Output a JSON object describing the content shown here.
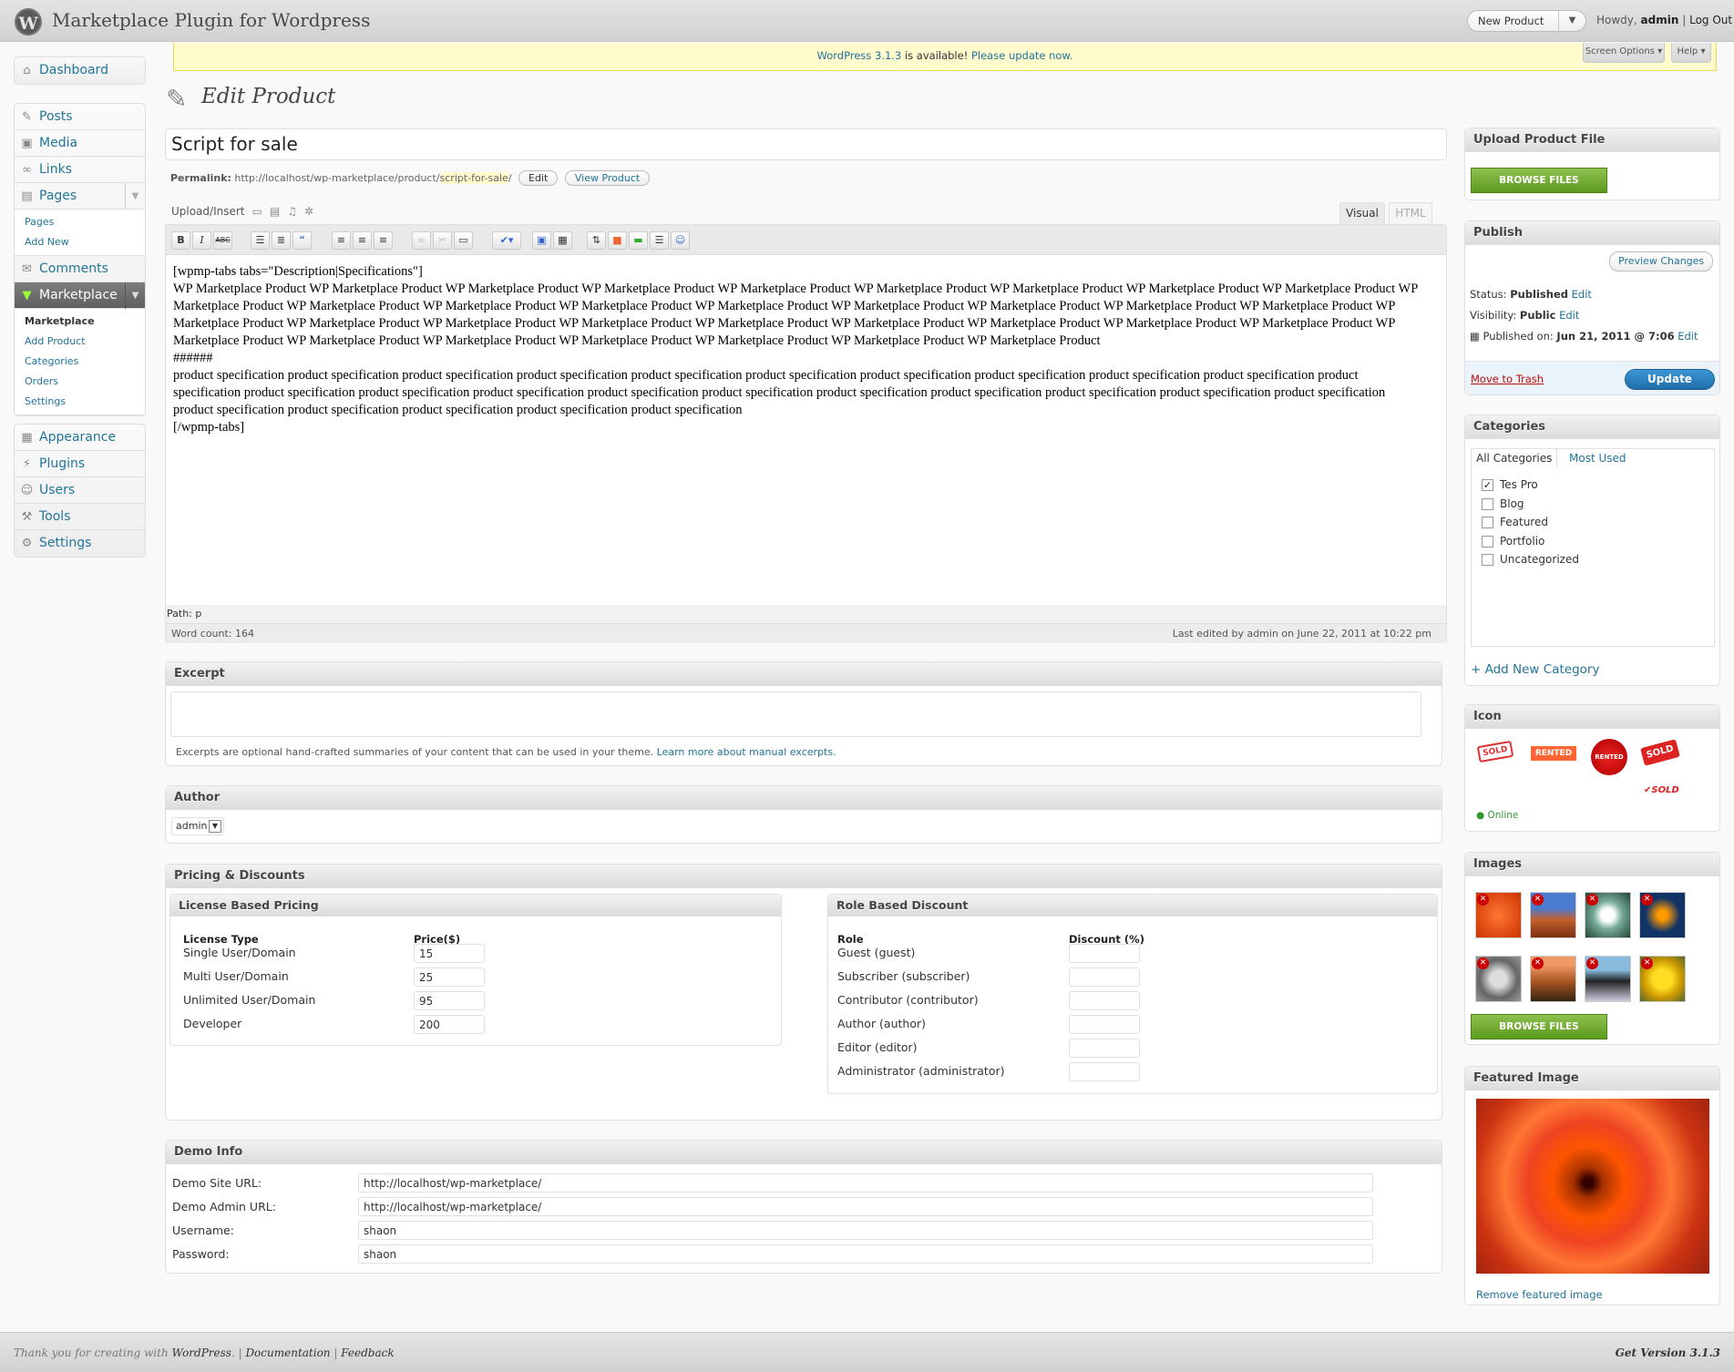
{
  "header": {
    "site_title": "Marketplace Plugin for Wordpress",
    "new_button": "New Product",
    "howdy": "Howdy,",
    "user": "admin",
    "separator": "|",
    "logout": "Log Out"
  },
  "nag": {
    "link1": "WordPress 3.1.3",
    "text": " is available! ",
    "link2": "Please update now."
  },
  "screen_options": "Screen Options",
  "help": "Help",
  "menu": {
    "dashboard": "Dashboard",
    "posts": "Posts",
    "media": "Media",
    "links": "Links",
    "pages": "Pages",
    "pages_sub": [
      "Pages",
      "Add New"
    ],
    "comments": "Comments",
    "marketplace": "Marketplace",
    "marketplace_sub": [
      "Marketplace",
      "Add Product",
      "Categories",
      "Orders",
      "Settings"
    ],
    "appearance": "Appearance",
    "plugins": "Plugins",
    "users": "Users",
    "tools": "Tools",
    "settings": "Settings"
  },
  "page": {
    "title": "Edit Product",
    "post_title": "Script for sale",
    "permalink_label": "Permalink:",
    "permalink_base": "http://localhost/wp-marketplace/product/",
    "permalink_slug": "script-for-sale",
    "permalink_end": "/",
    "edit_btn": "Edit",
    "view_btn": "View Product",
    "upload_insert": "Upload/Insert",
    "tab_visual": "Visual",
    "tab_html": "HTML"
  },
  "editor": {
    "line1": "[wpmp-tabs tabs=\"Description|Specifications\"]",
    "para1": "WP Marketplace Product WP Marketplace Product WP Marketplace Product WP Marketplace Product WP Marketplace Product WP Marketplace Product WP Marketplace Product WP Marketplace Product WP Marketplace Product WP Marketplace Product WP Marketplace Product WP Marketplace Product WP Marketplace Product WP Marketplace Product WP Marketplace Product WP Marketplace Product WP Marketplace Product WP Marketplace Product WP Marketplace Product WP Marketplace Product WP Marketplace Product WP Marketplace Product WP Marketplace Product WP Marketplace Product WP Marketplace Product WP Marketplace Product WP Marketplace Product WP Marketplace Product WP Marketplace Product WP Marketplace Product WP Marketplace Product WP Marketplace Product WP Marketplace Product WP Marketplace Product",
    "sep": "######",
    "para2": "product specification product specification product specification product specification product specification product specification product specification product specification product specification product specification product specification product specification product specification product specification product specification product specification product specification product specification product specification product specification product specification product specification product specification product specification product specification product specification",
    "line_end": "[/wpmp-tabs]",
    "path": "Path: p",
    "word_count": "Word count: 164",
    "last_edited": "Last edited by admin on June 22, 2011 at 10:22 pm"
  },
  "excerpt": {
    "title": "Excerpt",
    "help": "Excerpts are optional hand-crafted summaries of your content that can be used in your theme. ",
    "link": "Learn more about manual excerpts."
  },
  "author": {
    "title": "Author",
    "value": "admin"
  },
  "pricing": {
    "title": "Pricing & Discounts",
    "license_title": "License Based Pricing",
    "col_type": "License Type",
    "col_price": "Price($)",
    "licenses": [
      {
        "name": "Single User/Domain",
        "price": "15"
      },
      {
        "name": "Multi User/Domain",
        "price": "25"
      },
      {
        "name": "Unlimited User/Domain",
        "price": "95"
      },
      {
        "name": "Developer",
        "price": "200"
      }
    ],
    "role_title": "Role Based Discount",
    "col_role": "Role",
    "col_discount": "Discount (%)",
    "roles": [
      "Guest (guest)",
      "Subscriber (subscriber)",
      "Contributor (contributor)",
      "Author (author)",
      "Editor (editor)",
      "Administrator (administrator)"
    ]
  },
  "demo": {
    "title": "Demo Info",
    "fields": [
      {
        "label": "Demo Site URL:",
        "value": "http://localhost/wp-marketplace/"
      },
      {
        "label": "Demo Admin URL:",
        "value": "http://localhost/wp-marketplace/"
      },
      {
        "label": "Username:",
        "value": "shaon"
      },
      {
        "label": "Password:",
        "value": "shaon"
      }
    ]
  },
  "upload_box": {
    "title": "Upload Product File",
    "button": "BROWSE FILES"
  },
  "publish": {
    "title": "Publish",
    "preview": "Preview Changes",
    "status_label": "Status:",
    "status": "Published",
    "visibility_label": "Visibility:",
    "visibility": "Public",
    "published_label": "Published on:",
    "published": "Jun 21, 2011 @ 7:06",
    "edit": "Edit",
    "trash": "Move to Trash",
    "update": "Update"
  },
  "categories": {
    "title": "Categories",
    "tab_all": "All Categories",
    "tab_used": "Most Used",
    "items": [
      "Tes Pro",
      "Blog",
      "Featured",
      "Portfolio",
      "Uncategorized"
    ],
    "add_new": "+ Add New Category"
  },
  "icon_box": {
    "title": "Icon",
    "sold": "SOLD",
    "rented": "RENTED",
    "online": "Online"
  },
  "images_box": {
    "title": "Images",
    "button": "BROWSE FILES"
  },
  "featured": {
    "title": "Featured Image",
    "remove": "Remove featured image"
  },
  "footer": {
    "thanks": "Thank you for creating with ",
    "wp": "WordPress",
    "doc": "Documentation",
    "feedback": "Feedback",
    "version": "Get Version 3.1.3"
  },
  "colors": {
    "accent": "#21759b",
    "update_btn": "#2a87c7",
    "green_btn": "#6aa82f",
    "nag_bg": "#fffbcc"
  }
}
